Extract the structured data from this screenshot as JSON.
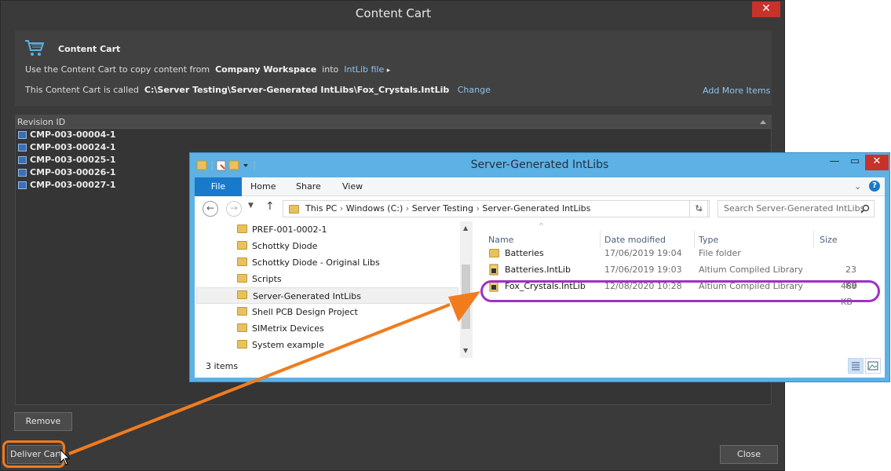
{
  "dialog": {
    "title": "Content Cart",
    "close_glyph": "✕",
    "header_title": "Content Cart",
    "line1": {
      "prefix": "Use the Content Cart to copy content from",
      "source": "Company Workspace",
      "middle": "into",
      "target": "IntLib file",
      "target_arrow": "▸"
    },
    "line2": {
      "prefix": "This Content Cart is called",
      "path": "C:\\Server Testing\\Server-Generated IntLibs\\Fox_Crystals.IntLib",
      "change": "Change"
    },
    "add_more": "Add More Items",
    "revision_header": "Revision ID",
    "revisions": [
      "CMP-003-00004-1",
      "CMP-003-00024-1",
      "CMP-003-00025-1",
      "CMP-003-00026-1",
      "CMP-003-00027-1"
    ],
    "remove_label": "Remove",
    "deliver_label": "Deliver Cart",
    "close_label": "Close",
    "icon_names": [
      "cart-icon",
      "component-chip-icon",
      "mouse-cursor-icon"
    ]
  },
  "explorer": {
    "title": "Server-Generated IntLibs",
    "min_glyph": "—",
    "max_glyph": "▭",
    "close_glyph": "✕",
    "tabs": [
      "File",
      "Home",
      "Share",
      "View"
    ],
    "breadcrumb": [
      "This PC",
      "Windows (C:)",
      "Server Testing",
      "Server-Generated IntLibs"
    ],
    "search_placeholder": "Search Server-Generated IntLibs",
    "nav_items": [
      "PREF-001-0002-1",
      "Schottky Diode",
      "Schottky Diode - Original Libs",
      "Scripts",
      "Server-Generated IntLibs",
      "Shell PCB Design Project",
      "SIMetrix Devices",
      "System example"
    ],
    "nav_selected": "Server-Generated IntLibs",
    "columns": [
      "Name",
      "Date modified",
      "Type",
      "Size"
    ],
    "files": [
      {
        "name": "Batteries",
        "date": "17/06/2019 19:04",
        "type": "File folder",
        "size": ""
      },
      {
        "name": "Batteries.IntLib",
        "date": "17/06/2019 19:03",
        "type": "Altium Compiled Library",
        "size": "23 KB"
      },
      {
        "name": "Fox_Crystals.IntLib",
        "date": "12/08/2020 10:28",
        "type": "Altium Compiled Library",
        "size": "489 KB"
      }
    ],
    "status": "3 items",
    "colors": {
      "accent": "#1979ca",
      "highlight_ring": "#a030c8",
      "arrow": "#f07c1e"
    }
  }
}
